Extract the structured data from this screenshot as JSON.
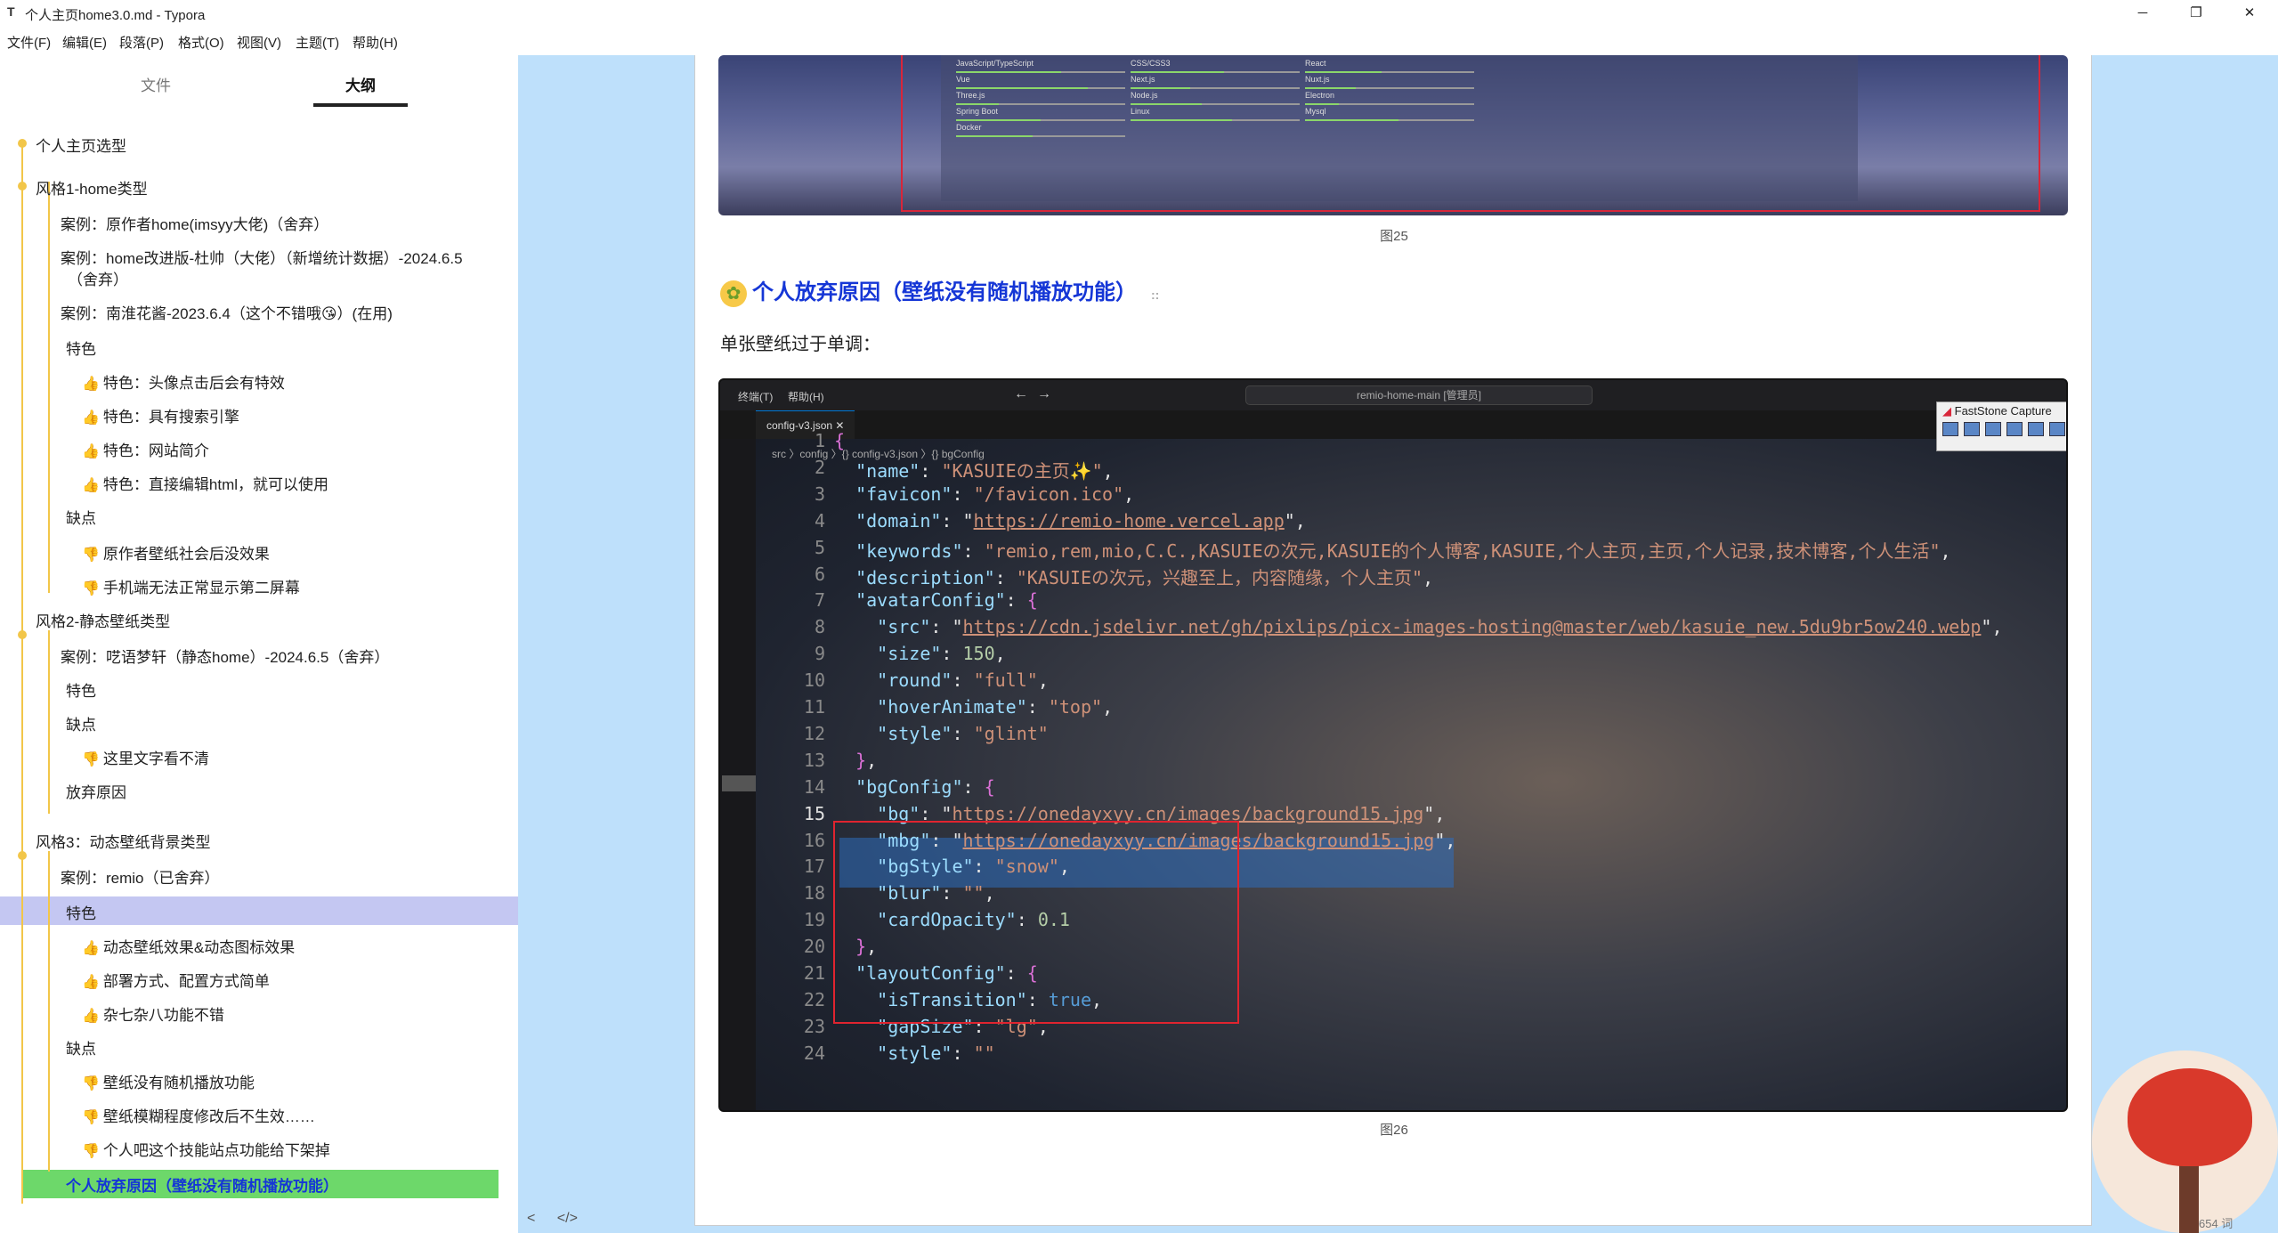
{
  "window": {
    "app_icon": "T",
    "title": "个人主页home3.0.md - Typora",
    "minimize": "─",
    "maximize": "❐",
    "close": "✕"
  },
  "menu": [
    "文件(F)",
    "编辑(E)",
    "段落(P)",
    "格式(O)",
    "视图(V)",
    "主题(T)",
    "帮助(H)"
  ],
  "sidebar": {
    "tabs": [
      "文件",
      "大纲"
    ],
    "outline": [
      "个人主页选型",
      "风格1-home类型",
      "案例：原作者home(imsyy大佬)（舍弃）",
      "案例：home改进版-杜帅（大佬）（新增统计数据）-2024.6.5",
      "（舍弃）",
      "案例：南淮花酱-2023.6.4（这个不错哦😘）(在用)",
      "特色",
      "特色：头像点击后会有特效",
      "特色：具有搜索引擎",
      "特色：网站简介",
      "特色：直接编辑html，就可以使用",
      "缺点",
      "原作者壁纸社会后没效果",
      "手机端无法正常显示第二屏幕",
      "风格2-静态壁纸类型",
      "案例：呓语梦轩（静态home）-2024.6.5（舍弃）",
      "特色",
      "缺点",
      "这里文字看不清",
      "放弃原因",
      "风格3：动态壁纸背景类型",
      "案例：remio（已舍弃）",
      "特色",
      "动态壁纸效果&动态图标效果",
      "部署方式、配置方式简单",
      "杂七杂八功能不错",
      "缺点",
      "壁纸没有随机播放功能",
      "壁纸模糊程度修改后不生效……",
      "个人吧这个技能站点功能给下架掉",
      "个人放弃原因（壁纸没有随机播放功能）"
    ],
    "bottom": {
      "back": "<",
      "source": "</>"
    }
  },
  "editor": {
    "skills": [
      {
        "name": "JavaScript/TypeScript",
        "level": 0.62
      },
      {
        "name": "CSS/CSS3",
        "level": 0.55
      },
      {
        "name": "React",
        "level": 0.45
      },
      {
        "name": "Vue",
        "level": 0.78
      },
      {
        "name": "Next.js",
        "level": 0.35
      },
      {
        "name": "Nuxt.js",
        "level": 0.3
      },
      {
        "name": "Three.js",
        "level": 0.25
      },
      {
        "name": "Node.js",
        "level": 0.42
      },
      {
        "name": "Electron",
        "level": 0.2
      },
      {
        "name": "Spring Boot",
        "level": 0.5
      },
      {
        "name": "Linux",
        "level": 0.6
      },
      {
        "name": "Mysql",
        "level": 0.55
      },
      {
        "name": "Docker",
        "level": 0.45
      }
    ],
    "caption25": "图25",
    "heading": "个人放弃原因（壁纸没有随机播放功能）",
    "heading_anchor": "::",
    "paragraph": "单张壁纸过于单调：",
    "caption26": "图26",
    "vscode": {
      "menu_terminal": "终端(T)",
      "menu_help": "帮助(H)",
      "search": "remio-home-main [管理员]",
      "tab": "config-v3.json",
      "tab_close": "✕",
      "breadcrumb": "src 〉config 〉{} config-v3.json 〉{} bgConfig",
      "lines": [
        "1",
        "2",
        "3",
        "4",
        "5",
        "6",
        "7",
        "8",
        "9",
        "10",
        "11",
        "12",
        "13",
        "14",
        "15",
        "16",
        "17",
        "18",
        "19",
        "20",
        "21",
        "22",
        "23",
        "24"
      ],
      "code": [
        "{",
        "  \"name\": \"KASUIEの主页✨\",",
        "  \"favicon\": \"/favicon.ico\",",
        "  \"domain\": \"https://remio-home.vercel.app\",",
        "  \"keywords\": \"remio,rem,mio,C.C.,KASUIEの次元,KASUIE的个人博客,KASUIE,个人主页,主页,个人记录,技术博客,个人生活\",",
        "  \"description\": \"KASUIEの次元，兴趣至上，内容随缘，个人主页\",",
        "  \"avatarConfig\": {",
        "    \"src\": \"https://cdn.jsdelivr.net/gh/pixlips/picx-images-hosting@master/web/kasuie_new.5du9br5ow240.webp\",",
        "    \"size\": 150,",
        "    \"round\": \"full\",",
        "    \"hoverAnimate\": \"top\",",
        "    \"style\": \"glint\"",
        "  },",
        "  \"bgConfig\": {",
        "    \"bg\": \"https://onedayxyy.cn/images/background15.jpg\",",
        "    \"mbg\": \"https://onedayxyy.cn/images/background15.jpg\",",
        "    \"bgStyle\": \"snow\",",
        "    \"blur\": \"\",",
        "    \"cardOpacity\": 0.1",
        "  },",
        "  \"layoutConfig\": {",
        "    \"isTransition\": true,",
        "    \"gapSize\": \"lg\",",
        "    \"style\": \"\""
      ],
      "faststone": "FastStone Capture"
    }
  },
  "status": {
    "word_count": "654 词"
  },
  "colors": {
    "outline_line": "#f2c649",
    "heading": "#1536d6",
    "active_item": "#6dd86a",
    "hover_item": "#c4c7f2",
    "annotation_box": "#e0242f"
  }
}
